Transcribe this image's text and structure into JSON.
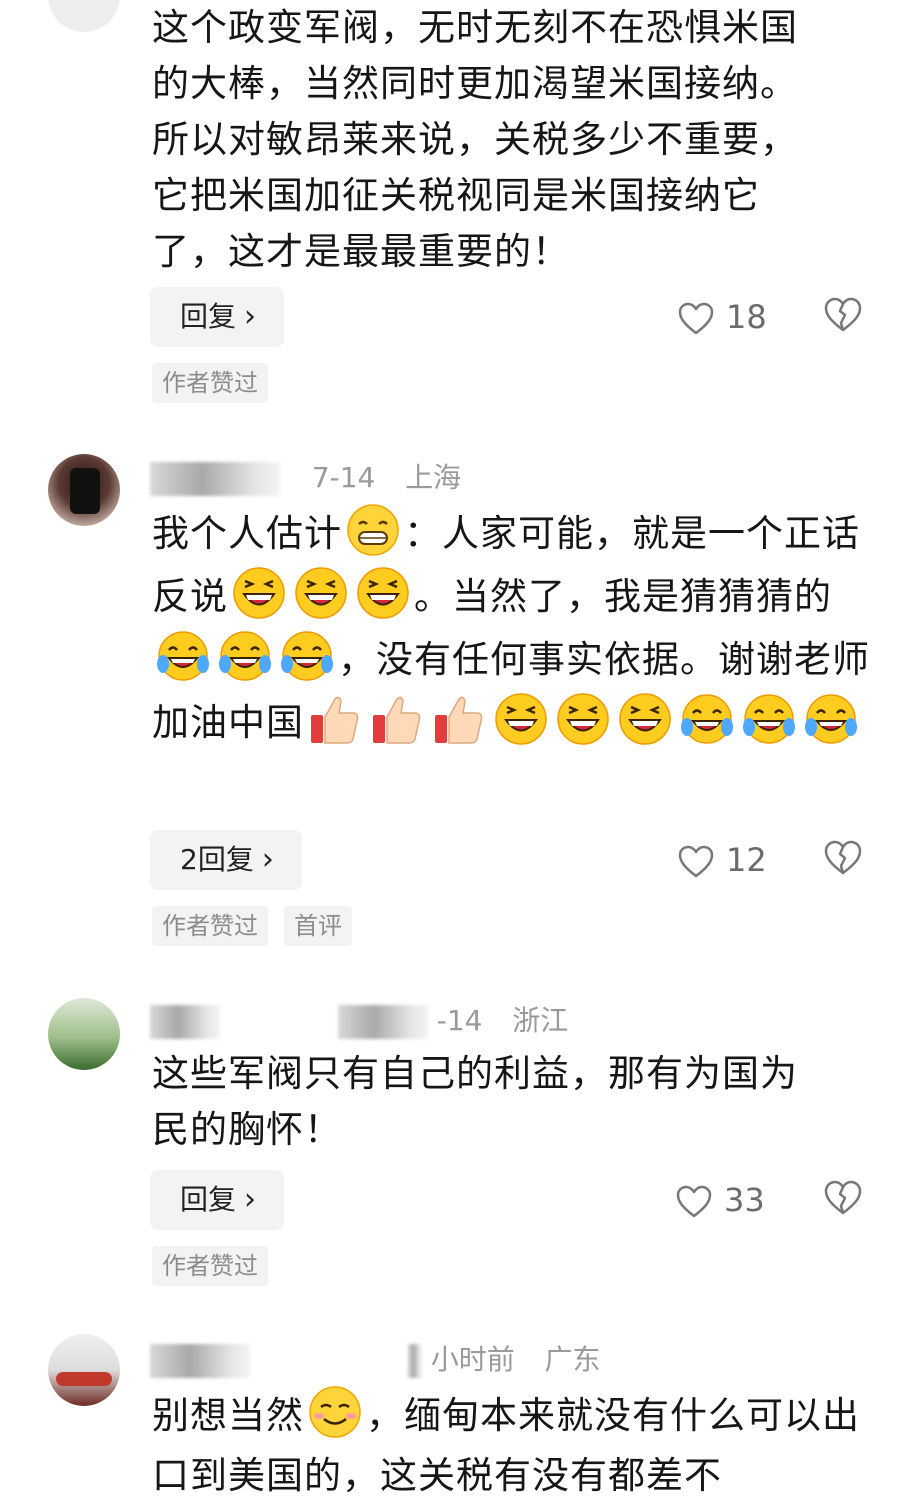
{
  "comments": [
    {
      "location": "",
      "date": "",
      "text_lines": [
        "这个政变军阀，无时无刻不在恐惧米国",
        "的大棒，当然同时更加渴望米国接纳。",
        "所以对敏昂莱来说，关税多少不重要，",
        "它把米国加征关税视同是米国接纳它",
        "了，这才是最最重要的！"
      ],
      "reply_label": "回复",
      "likes": "18",
      "tags": [
        "作者赞过"
      ]
    },
    {
      "date": "7-14",
      "location": "上海",
      "text_segments": [
        {
          "t": "我个人估计"
        },
        {
          "e": "grin"
        },
        {
          "t": "：人家可能，就是一个正话反说"
        },
        {
          "e": "laugh"
        },
        {
          "e": "laugh"
        },
        {
          "e": "laugh"
        },
        {
          "t": "。当然了，我是猜猜猜的"
        },
        {
          "e": "tears"
        },
        {
          "e": "tears"
        },
        {
          "e": "tears"
        },
        {
          "t": "，没有任何事实依据。谢谢老师加油中国"
        },
        {
          "e": "thumbsup"
        },
        {
          "e": "thumbsup"
        },
        {
          "e": "thumbsup"
        },
        {
          "e": "laugh"
        },
        {
          "e": "laugh"
        },
        {
          "e": "laugh"
        },
        {
          "e": "tears"
        },
        {
          "e": "tears"
        },
        {
          "e": "tears"
        }
      ],
      "reply_label": "2回复",
      "likes": "12",
      "tags": [
        "作者赞过",
        "首评"
      ]
    },
    {
      "date": "-14",
      "location": "浙江",
      "text_lines": [
        "这些军阀只有自己的利益，那有为国为",
        "民的胸怀！"
      ],
      "reply_label": "回复",
      "likes": "33",
      "tags": [
        "作者赞过"
      ]
    },
    {
      "date": "小时前",
      "location": "广东",
      "text_segments": [
        {
          "t": "别想当然"
        },
        {
          "e": "smirk"
        },
        {
          "t": "，缅甸本来就没有什么可以出口到美国的，这关税有没有都差不"
        }
      ]
    }
  ],
  "icons": {
    "like": "heart-outline-icon",
    "dislike": "broken-heart-icon",
    "chevron": "chevron-right-icon"
  }
}
